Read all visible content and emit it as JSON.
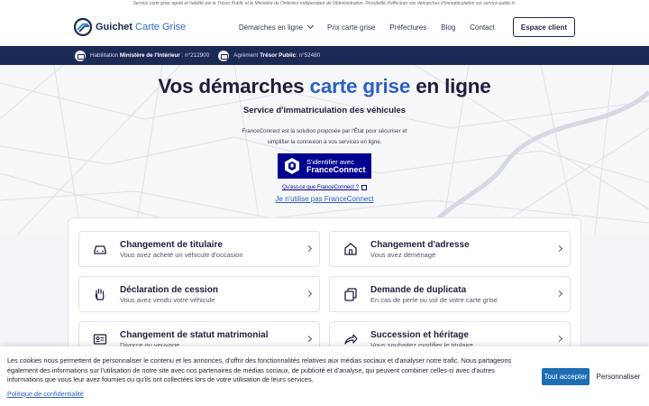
{
  "top_note": "Service carte grise agréé et habilité par le Trésor Public et le Ministère de l'Intérieur indépendant de l'Administration. Possibilité d'effectuer vos démarches d'immatriculation sur service-public.fr.",
  "brand": {
    "name_main": "Guichet",
    "name_accent": "Carte Grise"
  },
  "nav": {
    "items": [
      "Démarches en ligne",
      "Prix carte grise",
      "Préfectures",
      "Blog",
      "Contact"
    ],
    "client_button": "Espace client"
  },
  "badges": [
    {
      "prefix": "Habilitation ",
      "strong": "Ministère de l'Intérieur",
      "suffix": " : n°212900"
    },
    {
      "prefix": "Agrément ",
      "strong": "Trésor Public",
      "suffix": ": n°52480"
    }
  ],
  "hero": {
    "title_part1": "Vos démarches ",
    "title_accent": "carte grise",
    "title_part2": " en ligne",
    "subtitle": "Service d'immatriculation des véhicules",
    "fc_desc_line1": "FranceConnect est la solution proposée par l'État pour sécuriser et",
    "fc_desc_line2": "simplifier la connexion à vos services en ligne.",
    "fc_button_line1": "S'identifier avec",
    "fc_button_line2": "FranceConnect",
    "fc_what": "Qu'est-ce que FranceConnect ?",
    "fc_no": "Je n'utilise pas FranceConnect"
  },
  "services": [
    {
      "title": "Changement de titulaire",
      "sub": "Vous avez acheté un véhicule d'occasion",
      "icon": "car-icon"
    },
    {
      "title": "Changement d'adresse",
      "sub": "Vous avez déménagé",
      "icon": "home-icon"
    },
    {
      "title": "Déclaration de cession",
      "sub": "Vous avez vendu votre véhicule",
      "icon": "hand-icon"
    },
    {
      "title": "Demande de duplicata",
      "sub": "En cas de perte ou vol de votre carte grise",
      "icon": "copy-icon"
    },
    {
      "title": "Changement de statut matrimonial",
      "sub": "Divorce ou veuvage",
      "icon": "id-card-icon"
    },
    {
      "title": "Succession et héritage",
      "sub": "Vous souhaitez modifier le titulaire",
      "icon": "share-icon"
    }
  ],
  "cookie": {
    "text": "Les cookies nous permettent de personnaliser le contenu et les annonces, d'offrir des fonctionnalités relatives aux médias sociaux et d'analyser notre trafic. Nous partageons également des informations sur l'utilisation de notre site avec nos partenaires de médias sociaux, de publicité et d'analyse, qui peuvent combiner celles-ci avec d'autres informations que vous leur avez fournies ou qu'ils ont collectées lors de votre utilisation de leurs services.",
    "policy": "Politique de confidentialité",
    "accept": "Tout accepter",
    "customize": "Personnaliser"
  },
  "colors": {
    "navy": "#1b2a55",
    "accent": "#2d5fc4",
    "franceconnect": "#000091",
    "accept": "#1c6db3"
  }
}
